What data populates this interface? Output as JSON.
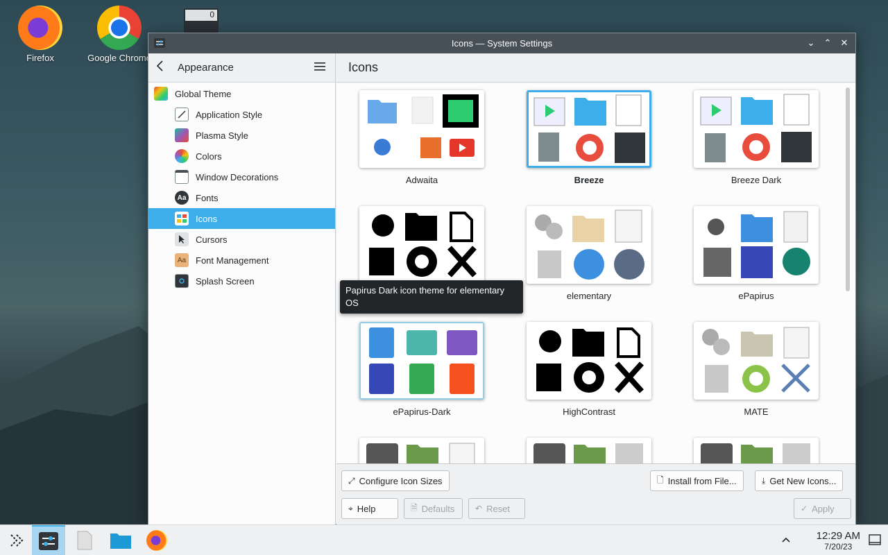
{
  "desktop": {
    "icons": [
      {
        "label": "Firefox"
      },
      {
        "label": "Google Chrome"
      }
    ],
    "calc_display": "0"
  },
  "window": {
    "title": "Icons — System Settings"
  },
  "sidebar": {
    "header": "Appearance",
    "items": [
      {
        "label": "Global Theme"
      },
      {
        "label": "Application Style"
      },
      {
        "label": "Plasma Style"
      },
      {
        "label": "Colors"
      },
      {
        "label": "Window Decorations"
      },
      {
        "label": "Fonts"
      },
      {
        "label": "Icons"
      },
      {
        "label": "Cursors"
      },
      {
        "label": "Font Management"
      },
      {
        "label": "Splash Screen"
      }
    ]
  },
  "main": {
    "title": "Icons",
    "themes": [
      {
        "name": "Adwaita"
      },
      {
        "name": "Breeze"
      },
      {
        "name": "Breeze Dark"
      },
      {
        "name": "Papirus Dark"
      },
      {
        "name": "elementary"
      },
      {
        "name": "ePapirus"
      },
      {
        "name": "ePapirus-Dark"
      },
      {
        "name": "HighContrast"
      },
      {
        "name": "MATE"
      }
    ],
    "selected_theme": "Breeze",
    "tooltip": "Papirus Dark icon theme for elementary OS"
  },
  "buttons": {
    "configure_sizes": "Configure Icon Sizes",
    "install_from_file": "Install from File...",
    "get_new_icons": "Get New Icons...",
    "help": "Help",
    "defaults": "Defaults",
    "reset": "Reset",
    "apply": "Apply"
  },
  "taskbar": {
    "time": "12:29 AM",
    "date": "7/20/23"
  },
  "colors": {
    "accent": "#3daee9",
    "titlebar": "#475057"
  }
}
